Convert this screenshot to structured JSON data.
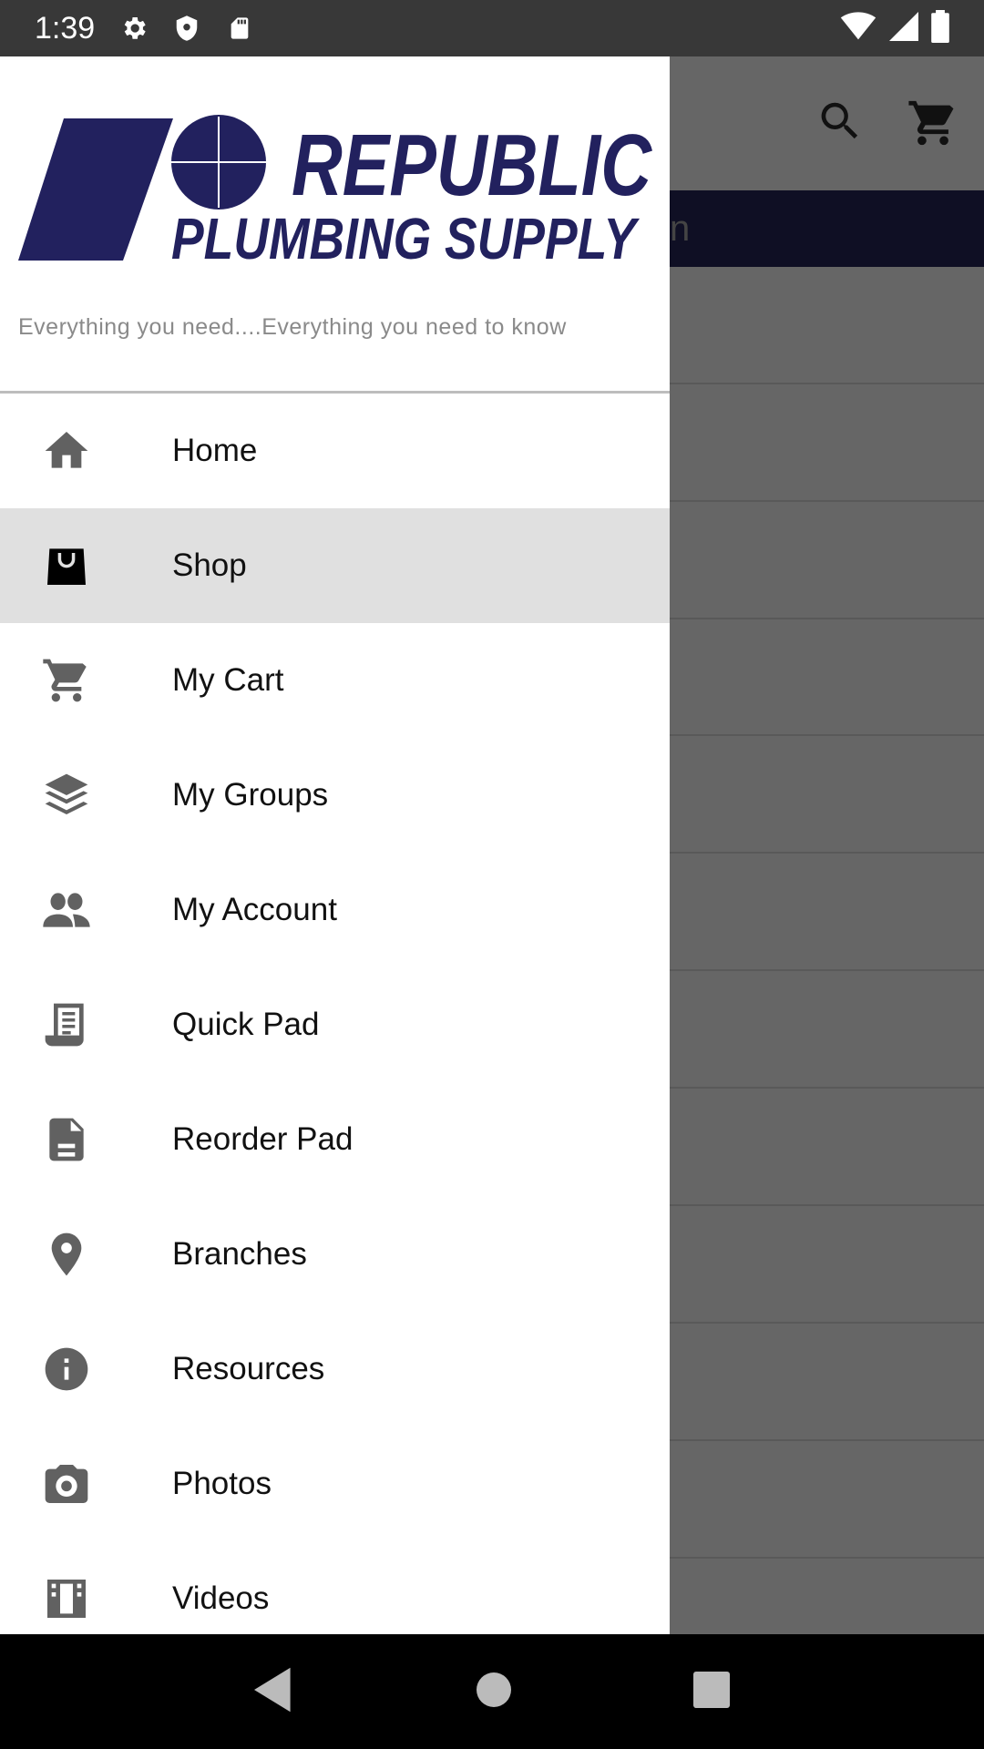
{
  "status_bar": {
    "time": "1:39",
    "icons": [
      "gear-icon",
      "shield-icon",
      "sd-card-icon",
      "wifi-icon",
      "signal-icon",
      "battery-icon"
    ]
  },
  "background": {
    "partial_text": "n",
    "icons": [
      "search-icon",
      "cart-icon"
    ]
  },
  "logo": {
    "line1": "REPUBLIC",
    "line2": "PLUMBING SUPPLY",
    "tagline": "Everything you need....Everything you need to know",
    "color": "#22215e"
  },
  "menu": {
    "active_index": 1,
    "items": [
      {
        "label": "Home",
        "icon": "home-icon"
      },
      {
        "label": "Shop",
        "icon": "shopping-bag-icon"
      },
      {
        "label": "My Cart",
        "icon": "cart-icon"
      },
      {
        "label": "My Groups",
        "icon": "layers-icon"
      },
      {
        "label": "My Account",
        "icon": "people-icon"
      },
      {
        "label": "Quick Pad",
        "icon": "receipt-icon"
      },
      {
        "label": "Reorder Pad",
        "icon": "document-icon"
      },
      {
        "label": "Branches",
        "icon": "location-pin-icon"
      },
      {
        "label": "Resources",
        "icon": "info-icon"
      },
      {
        "label": "Photos",
        "icon": "camera-icon"
      },
      {
        "label": "Videos",
        "icon": "film-icon"
      }
    ]
  },
  "nav_bar": {
    "icons": [
      "back-icon",
      "home-icon",
      "recents-icon"
    ]
  }
}
